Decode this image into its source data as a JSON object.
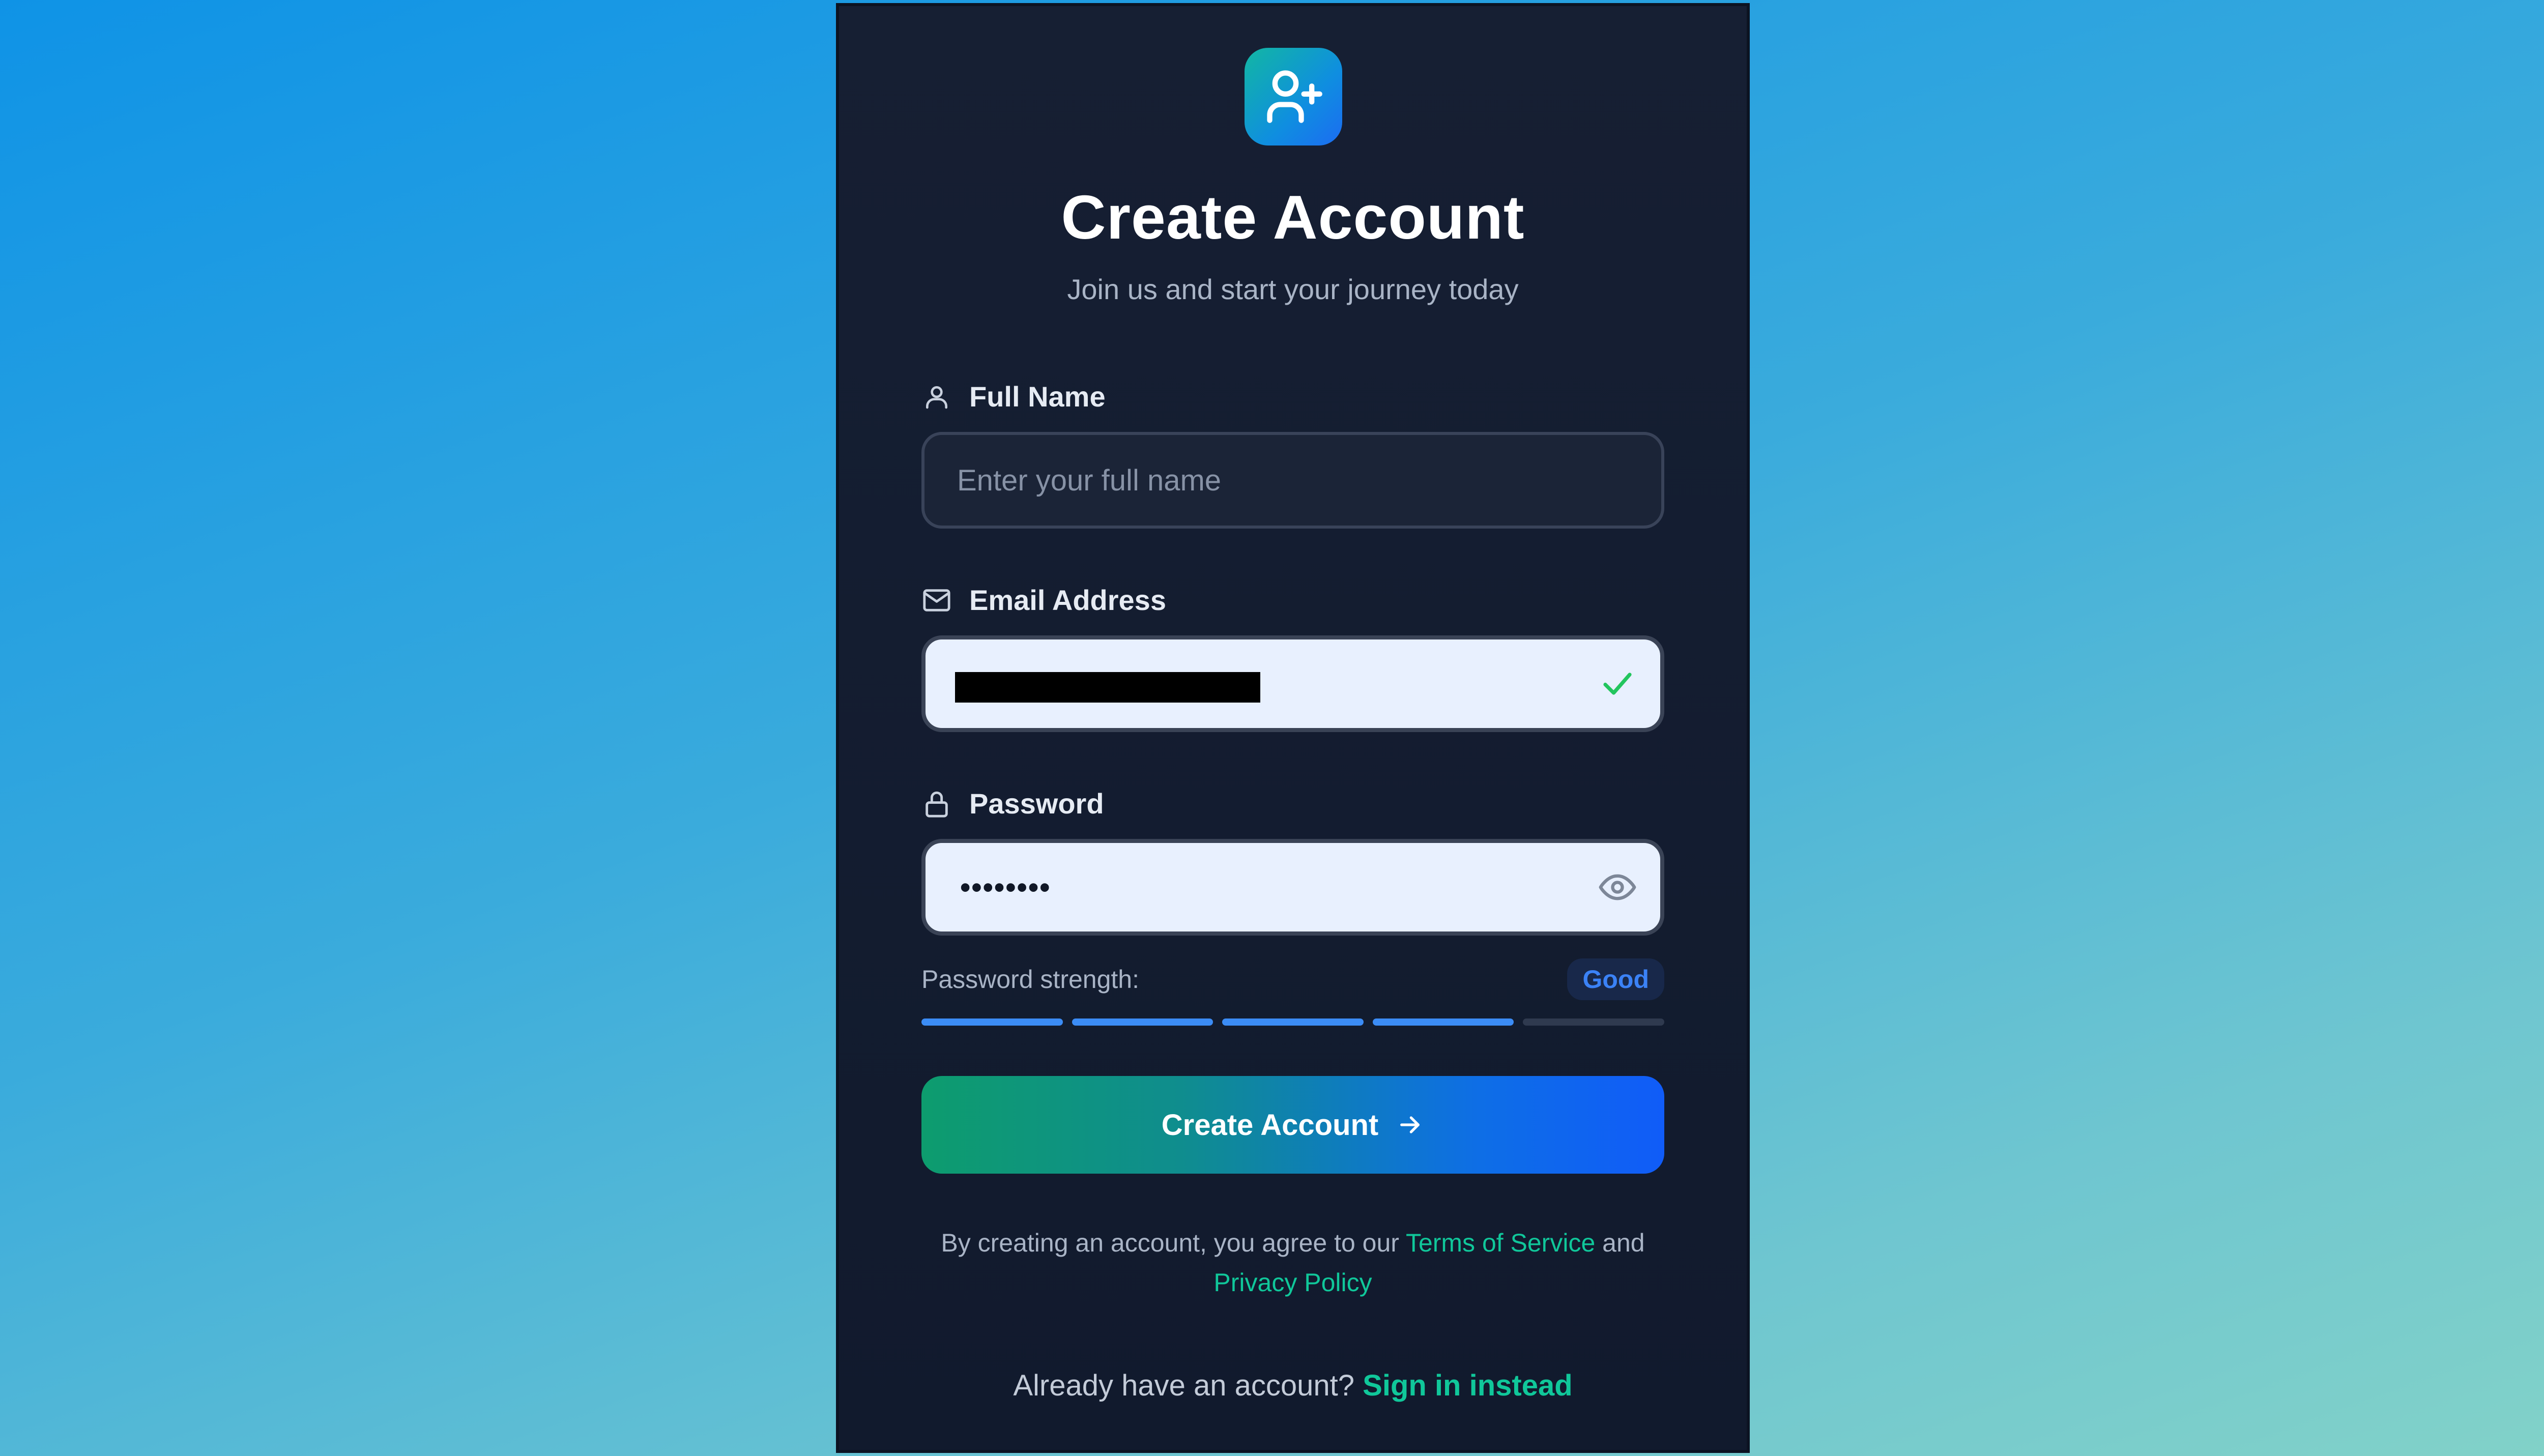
{
  "colors": {
    "accent_green": "#10c79a",
    "accent_blue": "#3b82f6",
    "card_bg": "#141d30",
    "success": "#22c55e"
  },
  "header": {
    "logo_icon": "user-plus-icon",
    "title": "Create Account",
    "subtitle": "Join us and start your journey today"
  },
  "form": {
    "full_name": {
      "label": "Full Name",
      "icon": "user-icon",
      "placeholder": "Enter your full name",
      "value": ""
    },
    "email": {
      "label": "Email Address",
      "icon": "mail-icon",
      "value_redacted": true,
      "valid_icon": "check-icon"
    },
    "password": {
      "label": "Password",
      "icon": "lock-icon",
      "masked_value": "••••••••",
      "toggle_icon": "eye-icon"
    },
    "strength": {
      "label": "Password strength:",
      "rating": "Good",
      "segments_total": 5,
      "segments_filled": 4
    },
    "submit": {
      "label": "Create Account",
      "icon": "arrow-right-icon"
    }
  },
  "legal": {
    "prefix": "By creating an account, you agree to our",
    "terms_link": "Terms of Service",
    "joiner": "and",
    "privacy_link": "Privacy Policy"
  },
  "signin": {
    "prompt": "Already have an account?",
    "link": "Sign in instead"
  }
}
